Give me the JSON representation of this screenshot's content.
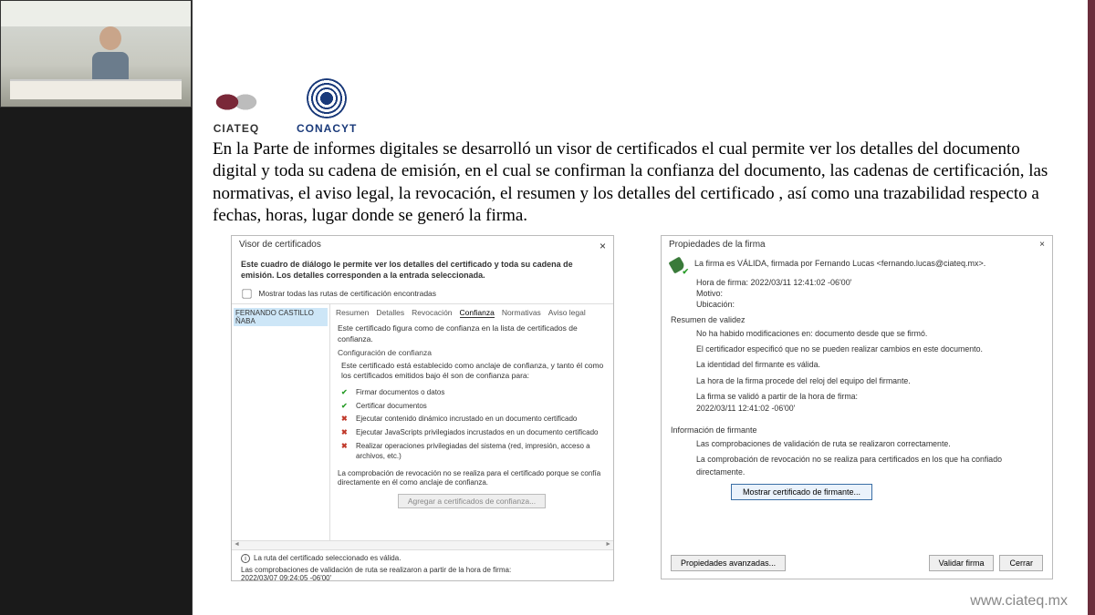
{
  "logos": {
    "ciateq": "CIATEQ",
    "conacyt": "CONACYT"
  },
  "main_text": "En la Parte de informes digitales se desarrolló un visor de certificados el cual permite ver los detalles del documento digital y toda su cadena de emisión, en el cual se confirman la confianza del documento, las cadenas de certificación, las normativas, el aviso legal, la revocación, el resumen y los detalles del certificado , así como una trazabilidad respecto a fechas, horas, lugar donde se generó la firma.",
  "footer_url": "www.ciateq.mx",
  "dlg1": {
    "title": "Visor de certificados",
    "close": "×",
    "intro": "Este cuadro de diálogo le permite ver los detalles del certificado y toda su cadena de emisión. Los detalles corresponden a la entrada seleccionada.",
    "chk_label": "Mostrar todas las rutas de certificación encontradas",
    "tree_item": "FERNANDO CASTILLO ÑABA",
    "tabs": {
      "resumen": "Resumen",
      "detalles": "Detalles",
      "revocacion": "Revocación",
      "confianza": "Confianza",
      "normativas": "Normativas",
      "aviso": "Aviso legal"
    },
    "tab_intro": "Este certificado figura como de confianza en la lista de certificados de confianza.",
    "config_hdr": "Configuración de confianza",
    "config_desc": "Este certificado está establecido como anclaje de confianza, y tanto él como los certificados emitidos bajo él son de confianza para:",
    "items": [
      {
        "ok": true,
        "text": "Firmar documentos o datos"
      },
      {
        "ok": true,
        "text": "Certificar documentos"
      },
      {
        "ok": false,
        "text": "Ejecutar contenido dinámico incrustado en un documento certificado"
      },
      {
        "ok": false,
        "text": "Ejecutar JavaScripts privilegiados incrustados en un documento certificado"
      },
      {
        "ok": false,
        "text": "Realizar operaciones privilegiadas del sistema (red, impresión, acceso a archivos, etc.)"
      }
    ],
    "revoc_note": "La comprobación de revocación no se realiza para el certificado porque se confía directamente en él como anclaje de confianza.",
    "add_btn": "Agregar a certificados de confianza...",
    "footer_valid": "La ruta del certificado seleccionado es válida.",
    "footer_checks": "Las comprobaciones de validación de ruta se realizaron a partir de la hora de firma:",
    "footer_time": "2022/03/07 09:24:05 -06'00'"
  },
  "dlg2": {
    "title": "Propiedades de la firma",
    "close": "×",
    "valid_line": "La firma es VÁLIDA, firmada por Fernando Lucas <fernando.lucas@ciateq.mx>.",
    "hora_label": "Hora de firma:",
    "hora_value": "2022/03/11 12:41:02 -06'00'",
    "motivo_label": "Motivo:",
    "ubic_label": "Ubicación:",
    "resumen_hdr": "Resumen de validez",
    "resumen": [
      "No ha habido modificaciones en: documento desde que se firmó.",
      "El certificador especificó que no se pueden realizar cambios en este documento.",
      "La identidad del firmante es válida.",
      "La hora de la firma procede del reloj del equipo del firmante.",
      "La firma se validó a partir de la hora de firma:\n2022/03/11 12:41:02 -06'00'"
    ],
    "info_hdr": "Información de firmante",
    "info": [
      "Las comprobaciones de validación de ruta se realizaron correctamente.",
      "La comprobación de revocación no se realiza para certificados en los que ha confiado directamente."
    ],
    "show_cert_btn": "Mostrar certificado de firmante...",
    "btn_adv": "Propiedades avanzadas...",
    "btn_validate": "Validar firma",
    "btn_close": "Cerrar"
  }
}
